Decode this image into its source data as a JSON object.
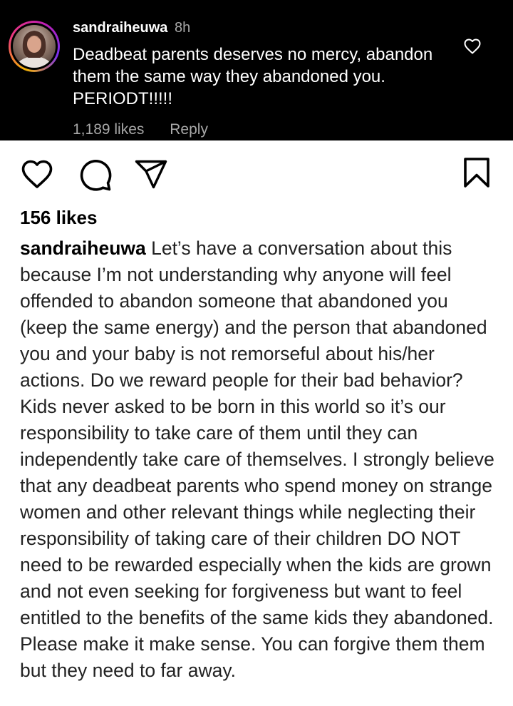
{
  "comment": {
    "username": "sandraiheuwa",
    "time": "8h",
    "text": "Deadbeat parents deserves no mercy, abandon them the same way they abandoned you. PERIODT!!!!!",
    "likes": "1,189 likes",
    "reply_label": "Reply"
  },
  "post": {
    "likes": "156 likes",
    "caption_username": "sandraiheuwa",
    "caption_text": " Let’s have a conversation about this because I’m not understanding why anyone will feel offended to abandon someone that abandoned you (keep the same energy) and the person that abandoned you and your baby is not remorseful about his/her actions. Do we reward people for their bad behavior? Kids never asked to be born in this world so it’s our responsibility to take care of them until they can independently take care of themselves. I strongly believe that any deadbeat parents who spend money on strange women and other relevant things while neglecting their responsibility of taking care of their children DO NOT need to be rewarded especially when the kids are grown and not even seeking for forgiveness but want to feel entitled to the benefits of the same kids they abandoned. Please make it make sense. You can forgive them them but they need to far away."
  },
  "icons": {
    "comment_like": "heart-outline-icon",
    "like": "heart-outline-icon",
    "comment": "speech-bubble-icon",
    "share": "paper-plane-icon",
    "save": "bookmark-icon"
  },
  "colors": {
    "header_background": "#000000",
    "secondary_text": "#a8a8a8",
    "story_ring": "#ee3a7a"
  }
}
